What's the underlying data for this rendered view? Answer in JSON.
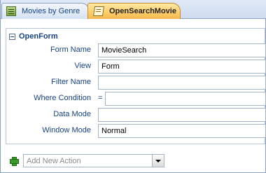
{
  "tabs": [
    {
      "label": "Movies by Genre",
      "icon": "form-icon",
      "active": false
    },
    {
      "label": "OpenSearchMovie",
      "icon": "macro-icon",
      "active": true
    }
  ],
  "action": {
    "name": "OpenForm",
    "arguments": [
      {
        "label": "Form Name",
        "value": "MovieSearch"
      },
      {
        "label": "View",
        "value": "Form"
      },
      {
        "label": "Filter Name",
        "value": ""
      },
      {
        "label": "Where Condition",
        "prefix": "=",
        "value": ""
      },
      {
        "label": "Data Mode",
        "value": ""
      },
      {
        "label": "Window Mode",
        "value": "Normal"
      }
    ]
  },
  "add_action": {
    "placeholder": "Add New Action"
  },
  "colors": {
    "label": "#15428b",
    "active_tab": "#ffcf6b",
    "border": "#8ca2c4"
  }
}
